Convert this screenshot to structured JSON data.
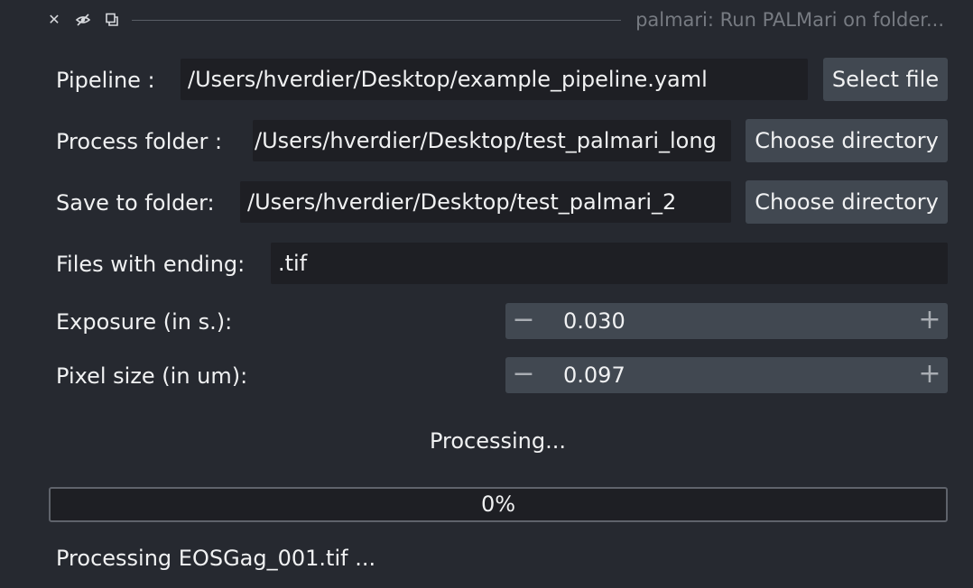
{
  "window": {
    "title": "palmari: Run PALMari on folder..."
  },
  "form": {
    "pipeline": {
      "label": "Pipeline :",
      "value": "/Users/hverdier/Desktop/example_pipeline.yaml",
      "button": "Select file"
    },
    "process_folder": {
      "label": "Process folder :",
      "value": "/Users/hverdier/Desktop/test_palmari_long",
      "button": "Choose directory"
    },
    "save_folder": {
      "label": "Save to folder:",
      "value": "/Users/hverdier/Desktop/test_palmari_2",
      "button": "Choose directory"
    },
    "files_ending": {
      "label": "Files with ending:",
      "value": ".tif"
    },
    "exposure": {
      "label": "Exposure (in s.):",
      "value": "0.030",
      "minus": "−",
      "plus": "+"
    },
    "pixel_size": {
      "label": "Pixel size (in um):",
      "value": "0.097",
      "minus": "−",
      "plus": "+"
    }
  },
  "status": {
    "processing_label": "Processing...",
    "progress_text": "0%",
    "progress_fraction": 0,
    "current_file": "Processing EOSGag_001.tif ..."
  }
}
